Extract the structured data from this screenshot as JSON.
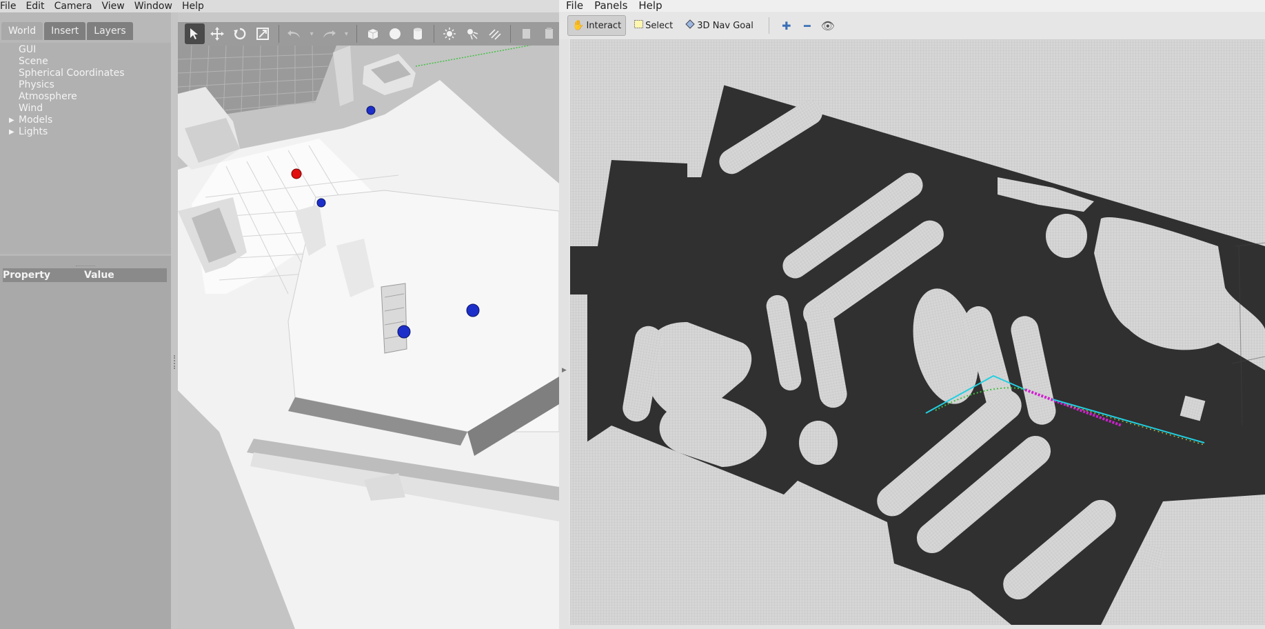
{
  "gazebo": {
    "menu": [
      "File",
      "Edit",
      "Camera",
      "View",
      "Window",
      "Help"
    ],
    "tabs": [
      "World",
      "Insert",
      "Layers"
    ],
    "tree": [
      {
        "label": "GUI",
        "expandable": false
      },
      {
        "label": "Scene",
        "expandable": false
      },
      {
        "label": "Spherical Coordinates",
        "expandable": false
      },
      {
        "label": "Physics",
        "expandable": false
      },
      {
        "label": "Atmosphere",
        "expandable": false
      },
      {
        "label": "Wind",
        "expandable": false
      },
      {
        "label": "Models",
        "expandable": true
      },
      {
        "label": "Lights",
        "expandable": true
      }
    ],
    "properties": {
      "col_property": "Property",
      "col_value": "Value"
    },
    "toolbar_icons": [
      "select-mode-icon",
      "translate-mode-icon",
      "rotate-mode-icon",
      "scale-mode-icon",
      "undo-icon",
      "redo-icon",
      "box-icon",
      "sphere-icon",
      "cylinder-icon",
      "point-light-icon",
      "spot-light-icon",
      "directional-light-icon",
      "copy-icon",
      "paste-icon"
    ],
    "colors": {
      "robot_red": "#e01010",
      "robot_blue": "#1d2fc9"
    }
  },
  "rviz": {
    "menu": [
      "File",
      "Panels",
      "Help"
    ],
    "tools": [
      {
        "label": "Interact",
        "icon": "hand-icon",
        "active": true
      },
      {
        "label": "Select",
        "icon": "select-box-icon",
        "active": false
      },
      {
        "label": "3D Nav Goal",
        "icon": "nav-goal-icon",
        "active": false
      }
    ],
    "colors": {
      "free_space": "#303030",
      "occupied": "#d4d4d4",
      "path_cyan": "#22d0e0",
      "path_magenta": "#d020d0",
      "path_green": "#40c040"
    }
  }
}
